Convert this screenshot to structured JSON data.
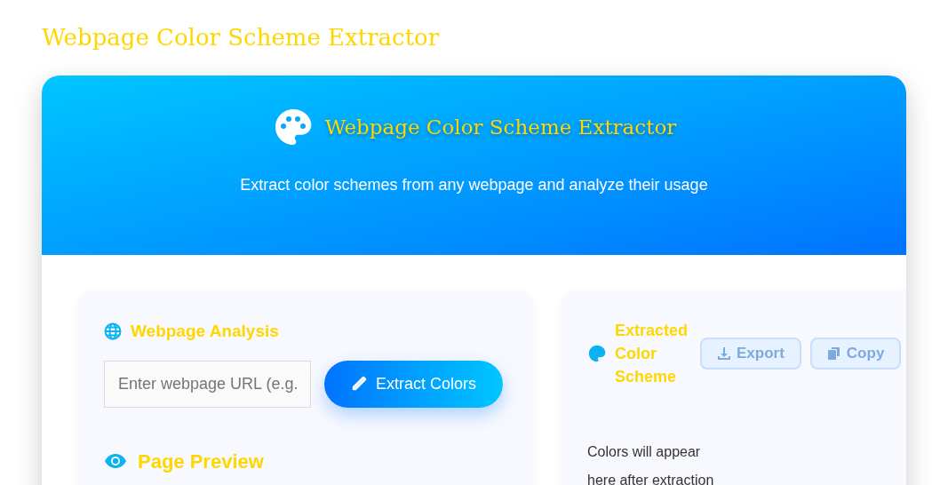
{
  "page_title": "Webpage Color Scheme Extractor",
  "header": {
    "title": "Webpage Color Scheme Extractor",
    "subtitle": "Extract color schemes from any webpage and analyze their usage"
  },
  "analysis": {
    "title": "Webpage Analysis",
    "url_field": {
      "placeholder": "Enter webpage URL (e.g."
    },
    "extract_button": {
      "label": "Extract Colors"
    }
  },
  "preview": {
    "title": "Page Preview"
  },
  "extracted": {
    "title": "Extracted Color Scheme",
    "buttons": [
      {
        "kind": "export",
        "label": "Export",
        "disabled": true
      },
      {
        "kind": "copy",
        "label": "Copy",
        "disabled": true
      }
    ],
    "empty_message": "Colors will appear here after extraction"
  }
}
